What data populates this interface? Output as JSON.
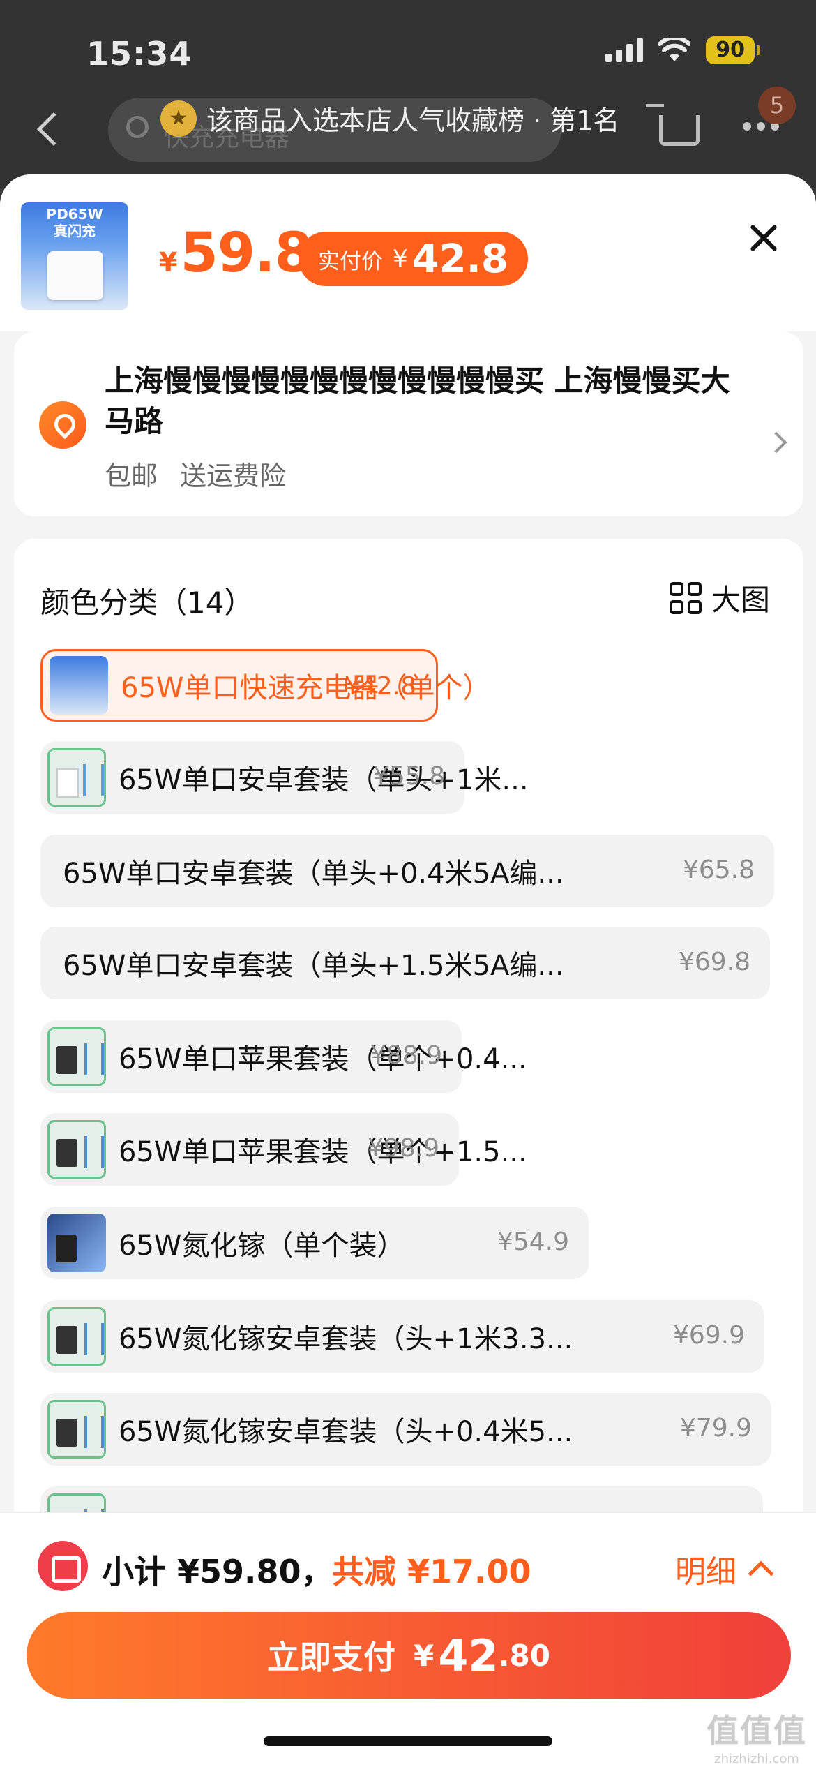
{
  "status_bar": {
    "time": "15:34",
    "battery": "90"
  },
  "nav": {
    "search_placeholder": "快充充电器",
    "banner_text": "该商品入选本店人气收藏榜 · 第1名",
    "cart_badge": "5"
  },
  "product": {
    "thumb_label_1": "PD65W",
    "thumb_label_2": "真闪充",
    "price_currency": "¥",
    "price": "59.8",
    "actual_label": "实付价",
    "actual_currency": "¥",
    "actual_price": "42.8"
  },
  "address": {
    "text": "上海慢慢慢慢慢慢慢慢慢慢慢慢买 上海慢慢买大马路",
    "tag_shipping": "包邮",
    "tag_insurance": "送运费险"
  },
  "options": {
    "title": "颜色分类（14）",
    "big_view": "大图",
    "items": [
      {
        "name": "65W单口快速充电器（单个）",
        "price": "¥42.8",
        "selected": true
      },
      {
        "name": "65W单口安卓套装（单头+1米...",
        "price": "¥55.8"
      },
      {
        "name": "65W单口安卓套装（单头+0.4米5A编...",
        "price": "¥65.8"
      },
      {
        "name": "65W单口安卓套装（单头+1.5米5A编...",
        "price": "¥69.8"
      },
      {
        "name": "65W单口苹果套装（单个+0.4...",
        "price": "¥88.9"
      },
      {
        "name": "65W单口苹果套装（单个+1.5...",
        "price": "¥98.9"
      },
      {
        "name": "65W氮化镓（单个装）",
        "price": "¥54.9"
      },
      {
        "name": "65W氮化镓安卓套装（头+1米3.3...",
        "price": "¥69.9"
      },
      {
        "name": "65W氮化镓安卓套装（头+0.4米5...",
        "price": "¥79.9"
      }
    ]
  },
  "footer": {
    "subtotal": "小计 ¥59.80，",
    "saved": "共减 ¥17.00",
    "detail": "明细",
    "pay_label": "立即支付",
    "pay_currency": "¥",
    "pay_int": "42",
    "pay_dec": ".80"
  },
  "watermark": {
    "line1": "值值值",
    "line2": "zhizhizhi.com"
  },
  "colors": {
    "accent": "#ff5e1b",
    "pay_gradient_start": "#ff7a2a",
    "pay_gradient_end": "#f0403a"
  }
}
